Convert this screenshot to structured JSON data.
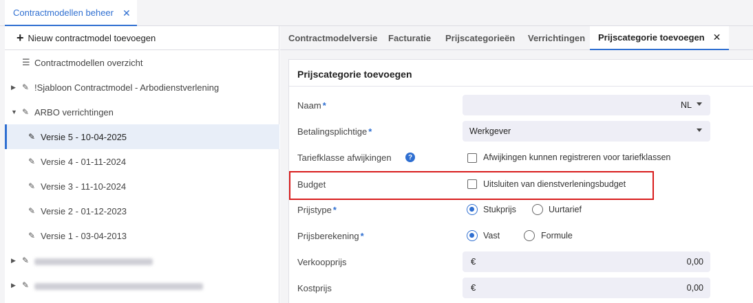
{
  "top_tab": {
    "label": "Contractmodellen beheer",
    "close": "✕"
  },
  "left": {
    "new_button": "Nieuw contractmodel toevoegen",
    "overview": "Contractmodellen overzicht",
    "tree": [
      {
        "label": "!Sjabloon Contractmodel - Arbodienstverlening"
      },
      {
        "label": "ARBO verrichtingen"
      },
      {
        "label": "Versie 5 - 10-04-2025"
      },
      {
        "label": "Versie 4 - 01-11-2024"
      },
      {
        "label": "Versie 3 - 11-10-2024"
      },
      {
        "label": "Versie 2 - 01-12-2023"
      },
      {
        "label": "Versie 1 - 03-04-2013"
      }
    ]
  },
  "tabs": [
    {
      "label": "Contractmodelversie"
    },
    {
      "label": "Facturatie"
    },
    {
      "label": "Prijscategorieën"
    },
    {
      "label": "Verrichtingen"
    },
    {
      "label": "Prijscategorie toevoegen",
      "close": "✕"
    }
  ],
  "form": {
    "title": "Prijscategorie toevoegen",
    "required_mark": "*",
    "naam": {
      "label": "Naam",
      "value": "NL"
    },
    "betalingsplichtige": {
      "label": "Betalingsplichtige",
      "value": "Werkgever"
    },
    "tariefklasse": {
      "label": "Tariefklasse afwijkingen",
      "help": "?",
      "checkbox_label": "Afwijkingen kunnen registreren voor tariefklassen",
      "checked": false
    },
    "budget": {
      "label": "Budget",
      "checkbox_label": "Uitsluiten van dienstverleningsbudget",
      "checked": false
    },
    "prijstype": {
      "label": "Prijstype",
      "options": [
        "Stukprijs",
        "Uurtarief"
      ],
      "selected": "Stukprijs"
    },
    "prijsberekening": {
      "label": "Prijsberekening",
      "options": [
        "Vast",
        "Formule"
      ],
      "selected": "Vast"
    },
    "verkoopprijs": {
      "label": "Verkoopprijs",
      "currency": "€",
      "value": "0,00"
    },
    "kostprijs": {
      "label": "Kostprijs",
      "currency": "€",
      "value": "0,00"
    }
  },
  "colors": {
    "accent": "#2f6fd1",
    "highlight": "#d81b1b",
    "field_bg": "#eeeef6"
  }
}
